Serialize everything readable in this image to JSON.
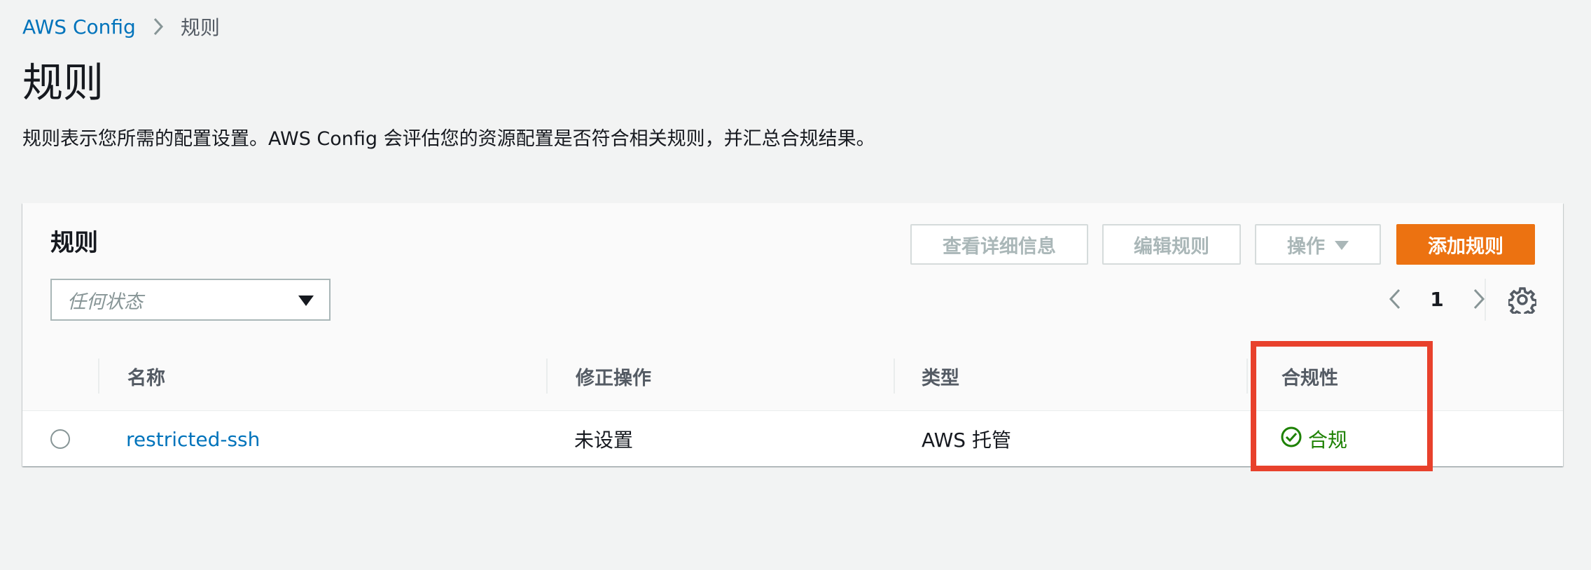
{
  "breadcrumb": {
    "root": "AWS Config",
    "current": "规则"
  },
  "page": {
    "title": "规则",
    "description": "规则表示您所需的配置设置。AWS Config 会评估您的资源配置是否符合相关规则，并汇总合规结果。"
  },
  "panel": {
    "title": "规则",
    "buttons": {
      "view_details": "查看详细信息",
      "edit_rule": "编辑规则",
      "actions": "操作",
      "add_rule": "添加规则"
    },
    "filter": {
      "placeholder": "任何状态"
    },
    "pagination": {
      "current_page": "1"
    }
  },
  "table": {
    "columns": [
      "名称",
      "修正操作",
      "类型",
      "合规性"
    ],
    "rows": [
      {
        "name": "restricted-ssh",
        "remediation": "未设置",
        "type": "AWS 托管",
        "compliance": "合规"
      }
    ]
  },
  "colors": {
    "link": "#0073bb",
    "primary_button": "#ec7211",
    "compliant": "#1d8102",
    "highlight": "#e8412c"
  },
  "icons": {
    "breadcrumb_separator": "chevron-right-icon",
    "dropdown": "caret-down-icon",
    "pager_prev": "chevron-left-icon",
    "pager_next": "chevron-right-icon",
    "settings": "gear-icon",
    "compliant": "check-circle-icon"
  }
}
